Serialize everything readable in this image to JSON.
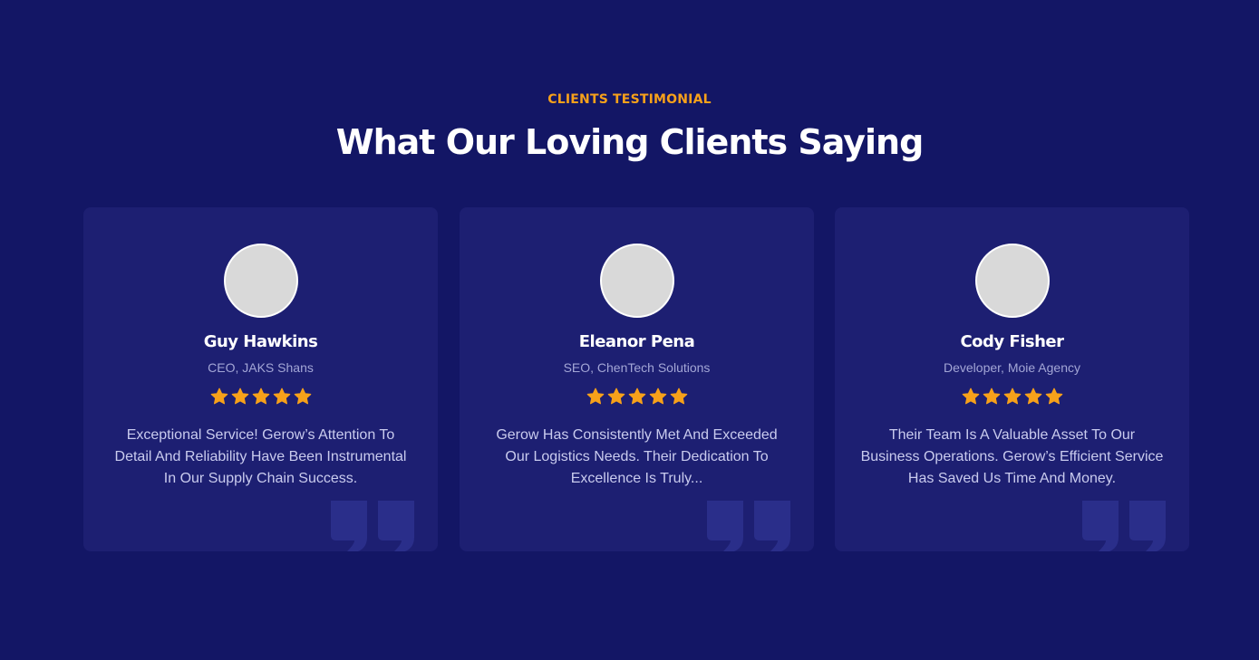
{
  "header": {
    "eyebrow": "CLIENTS TESTIMONIAL",
    "title": "What Our Loving Clients Saying"
  },
  "colors": {
    "background": "#131665",
    "card": "#1d1f72",
    "accent": "#f7a11a",
    "quote_mark": "#2a2e8a"
  },
  "testimonials": [
    {
      "name": "Guy Hawkins",
      "role": "CEO, JAKS Shans",
      "rating": 5,
      "quote": "Exceptional Service! Gerow’s Attention To Detail And Reliability Have Been Instrumental In Our Supply Chain Success.",
      "icon": "quote-icon"
    },
    {
      "name": "Eleanor Pena",
      "role": "SEO, ChenTech Solutions",
      "rating": 5,
      "quote": "Gerow Has Consistently Met And Exceeded Our Logistics Needs. Their Dedication To Excellence Is Truly...",
      "icon": "quote-icon"
    },
    {
      "name": "Cody Fisher",
      "role": "Developer, Moie Agency",
      "rating": 5,
      "quote": "Their Team Is A Valuable Asset To Our Business Operations. Gerow’s Efficient Service Has Saved Us Time And Money.",
      "icon": "quote-icon"
    }
  ]
}
